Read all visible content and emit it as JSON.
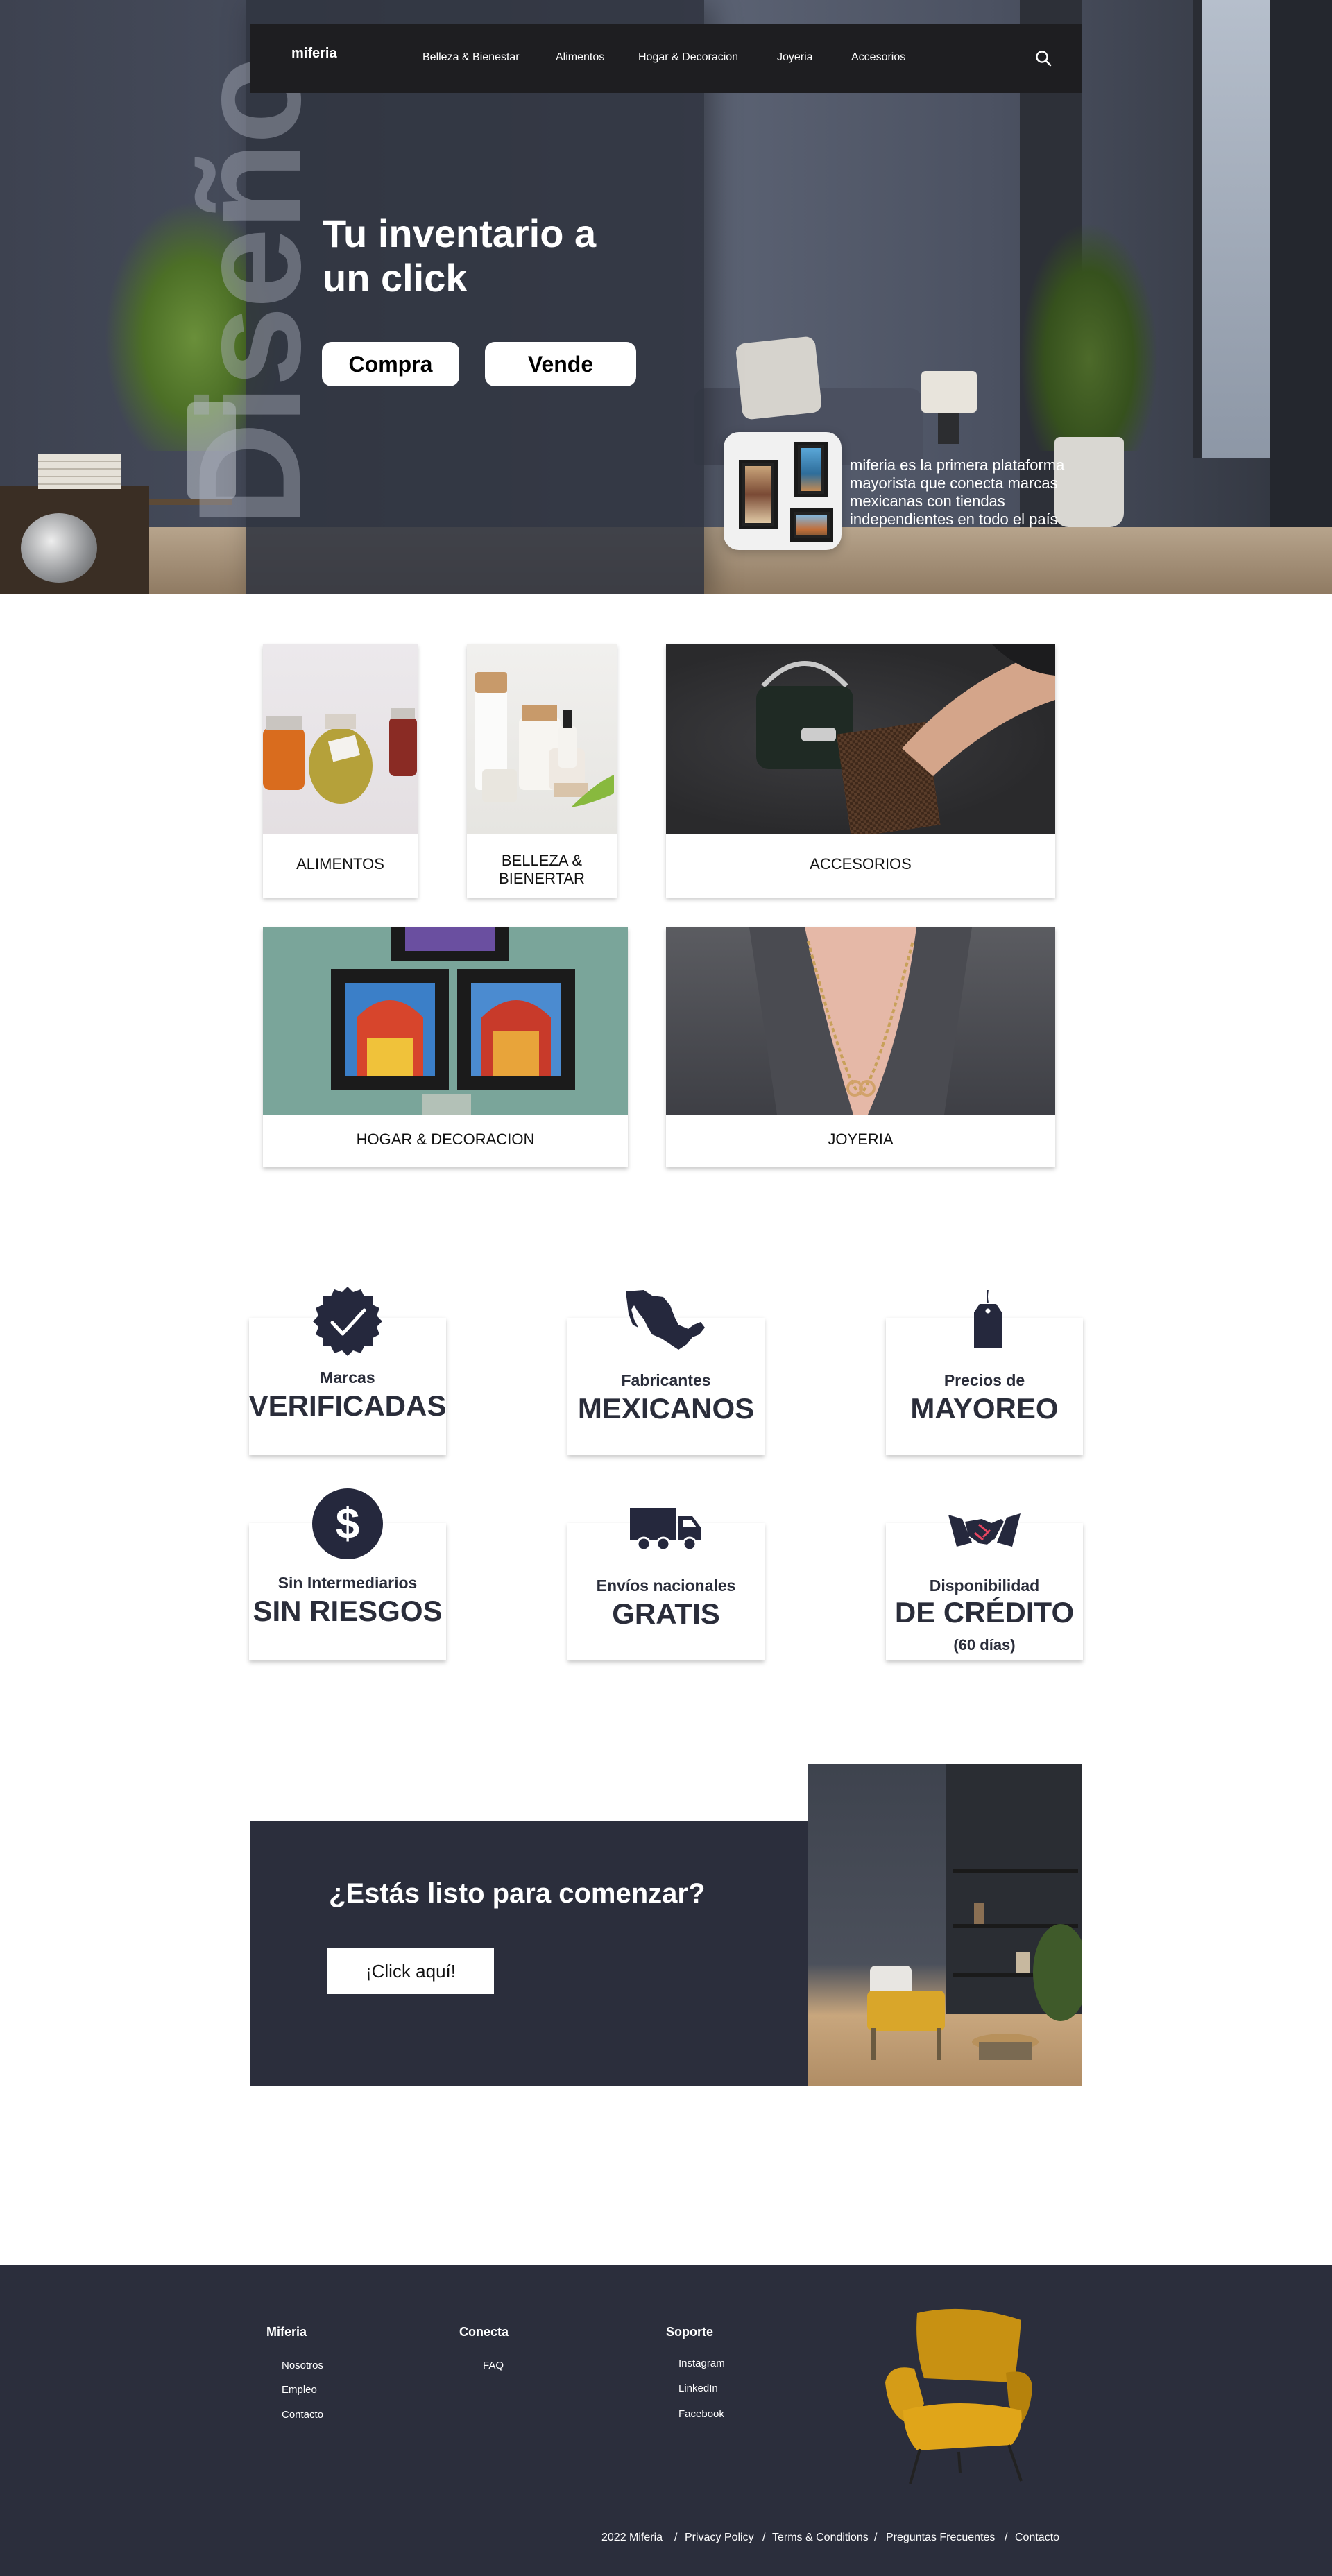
{
  "nav": {
    "logo": "miferia",
    "items": [
      "Belleza & Bienestar",
      "Alimentos",
      "Hogar & Decoracion",
      "Joyeria",
      "Accesorios"
    ],
    "search_icon": "search-icon"
  },
  "hero": {
    "vertical_word": "Diseño",
    "title": "Tu inventario a un click",
    "buttons": {
      "compra": "Compra",
      "vende": "Vende"
    },
    "blurb": "miferia es la primera plataforma mayorista que conecta marcas mexicanas con tiendas independientes en todo el país"
  },
  "categories": [
    {
      "label": "ALIMENTOS"
    },
    {
      "label": "BELLEZA & BIENERTAR"
    },
    {
      "label": "ACCESORIOS"
    },
    {
      "label": "HOGAR & DECORACION"
    },
    {
      "label": "JOYERIA"
    }
  ],
  "features": [
    {
      "small": "Marcas",
      "big": "VERIFICADAS",
      "icon": "verified-badge-icon"
    },
    {
      "small": "Fabricantes",
      "big": "MEXICANOS",
      "icon": "mexico-map-icon"
    },
    {
      "small": "Precios de",
      "big": "MAYOREO",
      "icon": "price-tag-icon"
    },
    {
      "small": "Sin Intermediarios",
      "big": "SIN RIESGOS",
      "icon": "dollar-coin-icon"
    },
    {
      "small": "Envíos nacionales",
      "big": "GRATIS",
      "icon": "truck-icon"
    },
    {
      "small": "Disponibilidad",
      "big": "DE CRÉDITO",
      "note": "(60 días)",
      "icon": "handshake-icon"
    }
  ],
  "cta": {
    "title": "¿Estás listo para comenzar?",
    "button": "¡Click aquí!"
  },
  "footer": {
    "columns": [
      {
        "heading": "Miferia",
        "links": [
          "Nosotros",
          "Empleo",
          "Contacto"
        ]
      },
      {
        "heading": "Conecta",
        "links": [
          "FAQ"
        ]
      },
      {
        "heading": "Soporte",
        "links": [
          "Instagram",
          "LinkedIn",
          "Facebook"
        ]
      }
    ],
    "bottom": {
      "copyright": "2022 Miferia",
      "links": [
        "Privacy Policy",
        "Terms & Conditions",
        "Preguntas Frecuentes",
        "Contacto"
      ],
      "separator": "/"
    }
  },
  "colors": {
    "navy": "#2b2e3c",
    "nav_bg": "#1e1e21",
    "icon_navy": "#25283d",
    "white": "#ffffff"
  }
}
